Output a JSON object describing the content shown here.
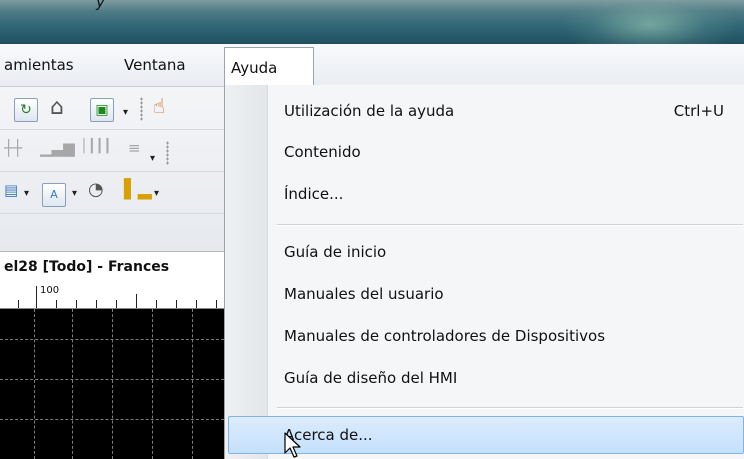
{
  "title_fragment": "y",
  "menubar": {
    "items": [
      {
        "label": "amientas"
      },
      {
        "label": "Ventana"
      },
      {
        "label": "Ayuda"
      }
    ]
  },
  "toolbar": {
    "icons": [
      "refresh-icon",
      "home-icon",
      "new-page-icon",
      "pointer-hand-icon",
      "bar-chart-icon",
      "gauge-icon",
      "window-icon",
      "column-chart-icon"
    ]
  },
  "document": {
    "header": "el28 [Todo] - Frances",
    "ruler_label": "100"
  },
  "dropdown": {
    "items": [
      {
        "label": "Utilización de la ayuda",
        "shortcut": "Ctrl+U"
      },
      {
        "label": "Contenido"
      },
      {
        "label": "Índice..."
      },
      {
        "label": "Guía de inicio"
      },
      {
        "label": "Manuales del usuario"
      },
      {
        "label": "Manuales de controladores de Dispositivos"
      },
      {
        "label": "Guía de diseño del HMI"
      },
      {
        "label": "Acerca de..."
      }
    ]
  },
  "colors": {
    "menu_highlight": "#c4e0fb",
    "highlight_border": "#7eb4ea",
    "canvas": "#000000"
  }
}
